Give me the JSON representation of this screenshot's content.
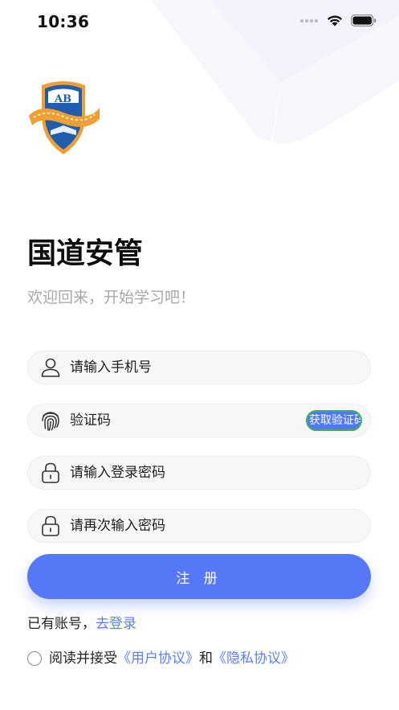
{
  "status_bar": {
    "time": "10:36"
  },
  "app": {
    "title": "国道安管",
    "welcome": "欢迎回来，开始学习吧！"
  },
  "form": {
    "phone_placeholder": "请输入手机号",
    "code_placeholder": "验证码",
    "code_button": "获取验证码",
    "password_placeholder": "请输入登录密码",
    "password_confirm_placeholder": "请再次输入密码",
    "submit_label": "注 册"
  },
  "login_prompt": {
    "text": "已有账号，",
    "link": "去登录"
  },
  "agreement": {
    "prefix": "阅读并接受",
    "user_agreement": "《用户协议》",
    "conjunction": "和",
    "privacy_policy": "《隐私协议》"
  },
  "logo": {
    "letters": "AB"
  },
  "colors": {
    "primary": "#5677f6",
    "link": "#5a7ef3",
    "code_button_border": "#39b552",
    "field_bg": "#f7f7fa",
    "decor": "#f4f5fd"
  },
  "icons": {
    "phone_field": "user-icon",
    "code_field": "fingerprint-icon",
    "password_field": "lock-icon",
    "password_confirm_field": "lock-icon"
  }
}
